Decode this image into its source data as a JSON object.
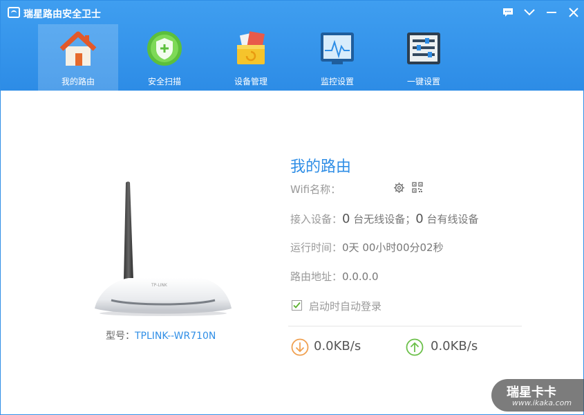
{
  "app": {
    "title": "瑞星路由安全卫士"
  },
  "nav": [
    {
      "label": "我的路由"
    },
    {
      "label": "安全扫描"
    },
    {
      "label": "设备管理"
    },
    {
      "label": "监控设置"
    },
    {
      "label": "一键设置"
    }
  ],
  "main": {
    "title": "我的路由",
    "wifi_label": "Wifi名称：",
    "devices_label": "接入设备：",
    "wireless_count": "0",
    "wireless_text": "台无线设备；",
    "wired_count": "0",
    "wired_text": "台有线设备",
    "uptime_label": "运行时间：",
    "uptime_value": "0天 00小时00分02秒",
    "address_label": "路由地址：",
    "address_value": "0.0.0.0",
    "autologin_label": "启动时自动登录",
    "autologin_checked": true,
    "download_speed": "0.0KB/s",
    "upload_speed": "0.0KB/s"
  },
  "router": {
    "model_label": "型号：",
    "model_value": "TPLINK--WR710N",
    "brand_text": "TP-LINK"
  },
  "watermark": {
    "text": "瑞星卡卡",
    "url": "www.ikaka.com"
  },
  "colors": {
    "accent": "#2f8ee6",
    "download": "#f0a050",
    "upload": "#6cc04a"
  }
}
